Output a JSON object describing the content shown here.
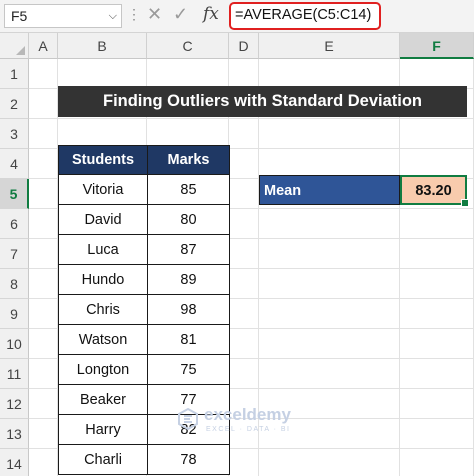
{
  "formula_bar": {
    "name_box": "F5",
    "formula": "=AVERAGE(C5:C14)",
    "fx_symbol": "fx"
  },
  "columns": [
    "A",
    "B",
    "C",
    "D",
    "E",
    "F"
  ],
  "selected_column": "F",
  "rows": [
    "1",
    "2",
    "3",
    "4",
    "5",
    "6",
    "7",
    "8",
    "9",
    "10",
    "11",
    "12",
    "13",
    "14"
  ],
  "selected_row": "5",
  "title": "Finding Outliers with Standard Deviation",
  "table": {
    "headers": [
      "Students",
      "Marks"
    ],
    "rows": [
      {
        "student": "Vitoria",
        "marks": "85"
      },
      {
        "student": "David",
        "marks": "80"
      },
      {
        "student": "Luca",
        "marks": "87"
      },
      {
        "student": "Hundo",
        "marks": "89"
      },
      {
        "student": "Chris",
        "marks": "98"
      },
      {
        "student": "Watson",
        "marks": "81"
      },
      {
        "student": "Longton",
        "marks": "75"
      },
      {
        "student": "Beaker",
        "marks": "77"
      },
      {
        "student": "Harry",
        "marks": "82"
      },
      {
        "student": "Charli",
        "marks": "78"
      }
    ]
  },
  "mean": {
    "label": "Mean",
    "value": "83.20"
  },
  "watermark": {
    "name": "exceldemy",
    "tagline": "EXCEL · DATA · BI"
  },
  "colors": {
    "title_bg": "#333333",
    "table_header_bg": "#1f3864",
    "mean_label_bg": "#2f5597",
    "mean_value_bg": "#f8cbad",
    "selection": "#107c41",
    "formula_highlight": "#e02020"
  }
}
